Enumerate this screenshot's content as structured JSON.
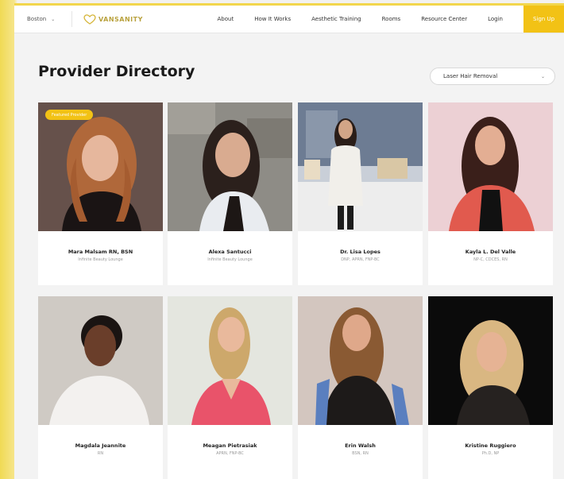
{
  "nav": {
    "city": "Boston",
    "logo_text": "VANSANITY",
    "items": [
      "About",
      "How It Works",
      "Aesthetic Training",
      "Rooms",
      "Resource Center",
      "Login"
    ],
    "signup": "Sign Up"
  },
  "page": {
    "title": "Provider Directory",
    "filter_value": "Laser Hair Removal"
  },
  "providers": [
    {
      "name": "Mara Malsam RN, BSN",
      "cred": "Infinite Beauty Lounge",
      "badge": "Featured Provider"
    },
    {
      "name": "Alexa Santucci",
      "cred": "Infinite Beauty Lounge"
    },
    {
      "name": "Dr. Lisa Lopes",
      "cred": "DNP, APRN, FNP-BC"
    },
    {
      "name": "Kayla L. Del Valle",
      "cred": "NP-C, CDCES, RN"
    },
    {
      "name": "Magdala Jeannite",
      "cred": "RN"
    },
    {
      "name": "Meagan Pietrasiak",
      "cred": "APRN, FNP-BC"
    },
    {
      "name": "Erin Walsh",
      "cred": "BSN, RN"
    },
    {
      "name": "Kristine Ruggiero",
      "cred": "Ph.D, NP"
    }
  ],
  "colors": {
    "accent": "#f2c215",
    "frame": "#f0da54"
  }
}
